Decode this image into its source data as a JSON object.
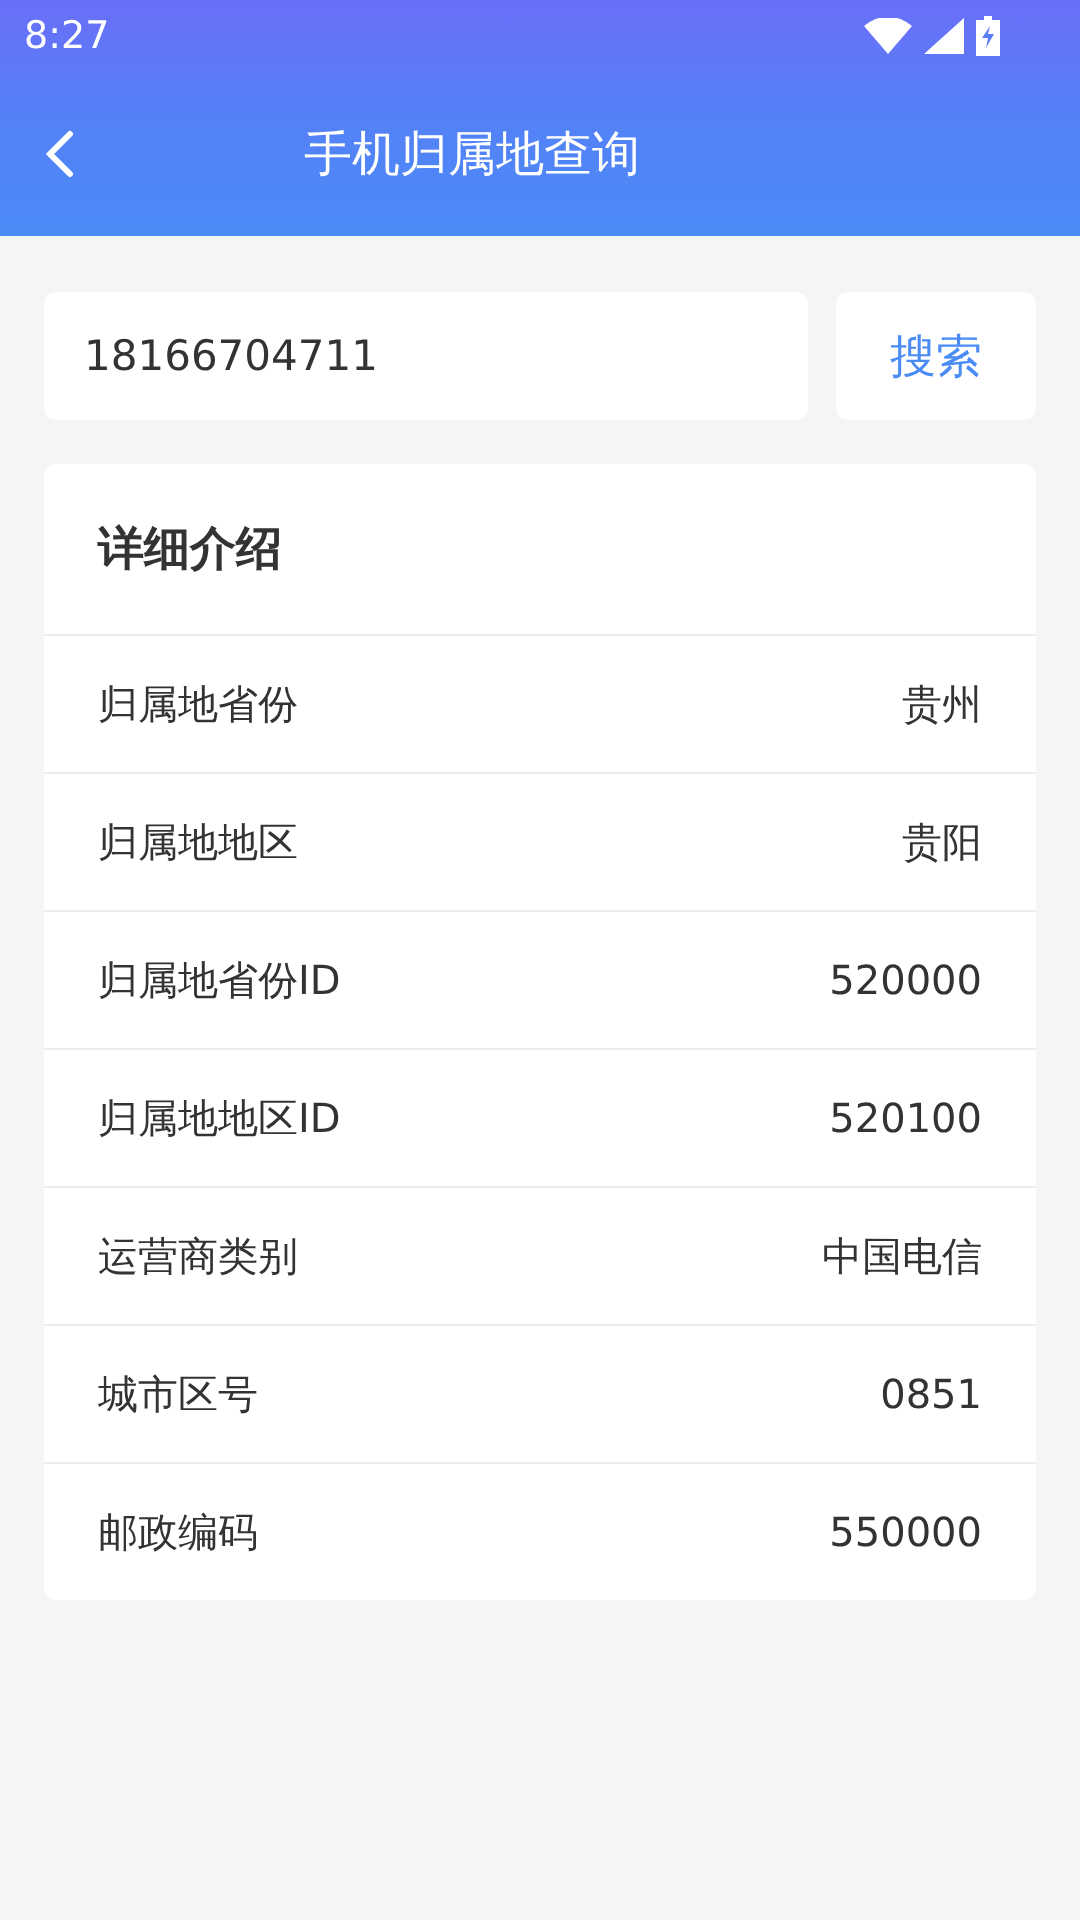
{
  "status_bar": {
    "time": "8:27"
  },
  "header": {
    "title": "手机归属地查询"
  },
  "search": {
    "value": "18166704711",
    "button": "搜索"
  },
  "card": {
    "title": "详细介绍",
    "rows": [
      {
        "label": "归属地省份",
        "value": "贵州"
      },
      {
        "label": "归属地地区",
        "value": "贵阳"
      },
      {
        "label": "归属地省份ID",
        "value": "520000"
      },
      {
        "label": "归属地地区ID",
        "value": "520100"
      },
      {
        "label": "运营商类别",
        "value": "中国电信"
      },
      {
        "label": "城市区号",
        "value": "0851"
      },
      {
        "label": "邮政编码",
        "value": "550000"
      }
    ]
  }
}
